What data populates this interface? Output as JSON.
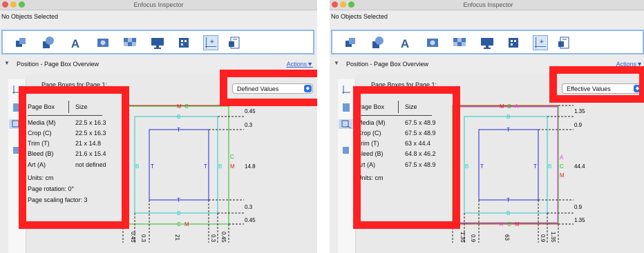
{
  "window": {
    "title": "Enfocus Inspector",
    "selection_status": "No Objects Selected"
  },
  "toolbar": {
    "icons": [
      "general-tool-icon",
      "color-shapes-icon",
      "text-icon",
      "image-icon",
      "transparency-icon",
      "display-icon",
      "layers-icon",
      "position-icon",
      "document-icon"
    ],
    "selected": "position-icon"
  },
  "section": {
    "title": "Position - Page Box Overview",
    "actions_label": "Actions"
  },
  "sidebar": {
    "icons": [
      "page-box-icon",
      "page-layout-icon",
      "scaling-icon",
      "crop-icon"
    ],
    "selected": "scaling-icon"
  },
  "page_boxes_heading": "Page Boxes for Page 1:",
  "table_headers": {
    "box": "Page Box",
    "size": "Size"
  },
  "panels": [
    {
      "dropdown": "Defined Values",
      "rows": [
        {
          "box": "Media (M)",
          "size": "22.5 x 16.3"
        },
        {
          "box": "Crop (C)",
          "size": "22.5 x 16.3"
        },
        {
          "box": "Trim (T)",
          "size": "21 x 14.8"
        },
        {
          "box": "Bleed (B)",
          "size": "21.6 x 15.4"
        },
        {
          "box": "Art (A)",
          "size": "not defined"
        }
      ],
      "units": "Units: cm",
      "rotation": "Page rotation: 0°",
      "scaling": "Page scaling factor: 3",
      "right_labels": [
        "0.45",
        "0.3",
        "14.8",
        "0.3",
        "0.45"
      ],
      "bottom_labels": [
        "0.45",
        "0.3",
        "21",
        "0.3",
        "0.45"
      ]
    },
    {
      "dropdown": "Effective Values",
      "rows": [
        {
          "box": "Media (M)",
          "size": "67.5 x 48.9"
        },
        {
          "box": "Crop (C)",
          "size": "67.5 x 48.9"
        },
        {
          "box": "Trim (T)",
          "size": "63 x 44.4"
        },
        {
          "box": "Bleed (B)",
          "size": "64.8 x 46.2"
        },
        {
          "box": "Art (A)",
          "size": "67.5 x 48.9"
        }
      ],
      "units": "Units: cm",
      "right_labels": [
        "1.35",
        "0.9",
        "44.4",
        "0.9",
        "1.35"
      ],
      "bottom_labels": [
        "1.35",
        "0.9",
        "63",
        "0.9",
        "1.35"
      ]
    }
  ],
  "box_letters": {
    "media": "M",
    "crop": "C",
    "trim": "T",
    "bleed": "B",
    "art": "A"
  },
  "colors": {
    "media": "#e8222a",
    "crop": "#1fbf1f",
    "trim": "#2222dd",
    "bleed": "#22cccc",
    "art": "#ff33ff",
    "highlight": "#ff2121",
    "accent": "#2d73e3"
  }
}
